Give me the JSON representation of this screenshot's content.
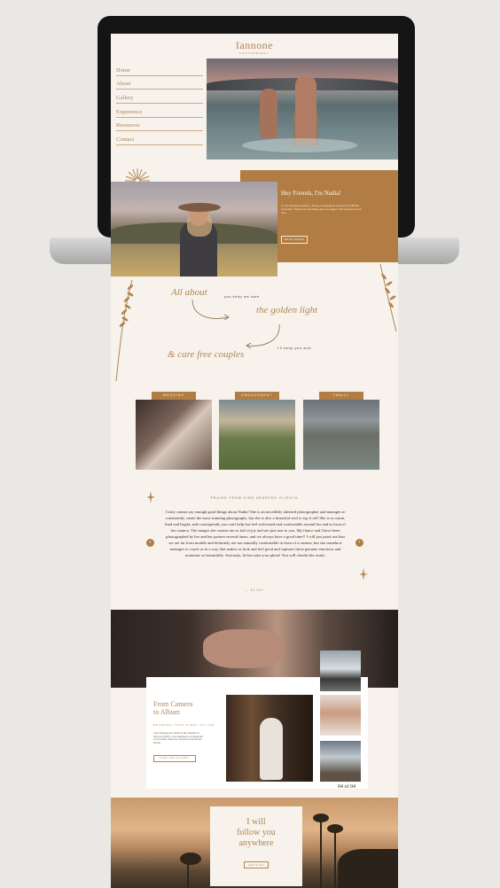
{
  "header": {
    "logo_text": "Iannone",
    "logo_sub": "PHOTOGRAPHY"
  },
  "nav": {
    "items": [
      "Home",
      "About",
      "Gallery",
      "Experience",
      "Resources",
      "Contact"
    ]
  },
  "intro": {
    "title": "Hey Friends, I'm Nadia!",
    "body": "I'm an intimate wedding + family photographer based out of British Columbia. Thanks for stumbling upon my page! I can't believe you're here.",
    "button": "READ MORE"
  },
  "about": {
    "line1": "All about",
    "note1": "you keep me safe",
    "line2": "the golden light",
    "note2": "I'll keep you wild",
    "line3": "& care free couples"
  },
  "categories": [
    {
      "label": "WEDDING"
    },
    {
      "label": "ENGAGEMENT"
    },
    {
      "label": "FAMILY"
    }
  ],
  "testimonial": {
    "title": "PRAISE FROM KIND HEARTED CLIENTS",
    "body": "I truly cannot say enough good things about Nadia! She is an incredibly talented photographer and manages to consistently create the most stunning photographs, but she is also a beautiful soul to top it off! She is so warm, kind and bright, and consequently you can't help but feel welcomed and comfortable around her and in front of her camera. The images she creates are so full of joy and are just true to you. My fiance and I have been photographed by her and her partner several times, and we always have a good time!! I will just point out that we are far from models and definitely are not naturally comfortable in front of a camera, but she somehow manages to coach us in a way that makes us look and feel good and captures these genuine emotions and moments so beautifully. Seriously, let her take your photo! You will cherish the result.",
    "signature": "— ELISE",
    "prev_icon": "‹",
    "next_icon": "›"
  },
  "album": {
    "title_line1": "From Camera",
    "title_line2": "to Album",
    "subtitle": "BRINGING YOUR STORY TO LIFE",
    "body": "I love bringing your stories to life, whether it's with your family in your backyard or a casual day on the beach, these are moments you'll cherish forever.",
    "button": "VIEW THE GALLERY",
    "counter": "04 of 04"
  },
  "follow": {
    "line1": "I will",
    "line2": "follow you",
    "line3": "anywhere",
    "button": "LET'S GO"
  },
  "colors": {
    "accent": "#b17d44",
    "cream": "#f7f3ec",
    "text_dark": "#3a2e26"
  },
  "icons": {
    "sunburst": "sunburst-icon",
    "sparkle": "sparkle-icon",
    "sprig": "wheat-sprig-icon"
  }
}
